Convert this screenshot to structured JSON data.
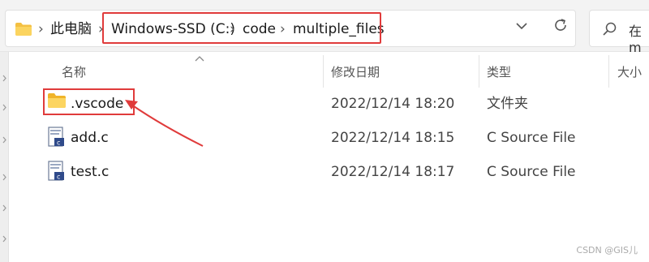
{
  "address": {
    "root": "此电脑",
    "segments": [
      "Windows-SSD (C:)",
      "code",
      "multiple_files"
    ],
    "icon": "folder-icon"
  },
  "toolbar": {
    "history_icon": "chevron-down-icon",
    "refresh_icon": "refresh-icon"
  },
  "search": {
    "placeholder": "在 m",
    "icon": "search-icon"
  },
  "columns": {
    "name": "名称",
    "modified": "修改日期",
    "type": "类型",
    "size": "大小"
  },
  "files": [
    {
      "name": ".vscode",
      "modified": "2022/12/14 18:20",
      "type": "文件夹",
      "icon": "folder-icon"
    },
    {
      "name": "add.c",
      "modified": "2022/12/14 18:15",
      "type": "C Source File",
      "icon": "c-source-file-icon"
    },
    {
      "name": "test.c",
      "modified": "2022/12/14 18:17",
      "type": "C Source File",
      "icon": "c-source-file-icon"
    }
  ],
  "annotation_color": "#e03b3b",
  "watermark": "CSDN @GIS儿"
}
